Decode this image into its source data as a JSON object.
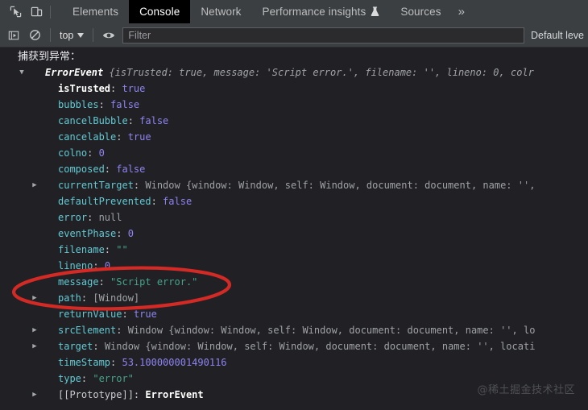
{
  "tabbar": {
    "inspect_icon": "inspect-element-icon",
    "device_icon": "device-toolbar-icon",
    "tabs": [
      {
        "label": "Elements",
        "active": false,
        "experimental": false
      },
      {
        "label": "Console",
        "active": true,
        "experimental": false
      },
      {
        "label": "Network",
        "active": false,
        "experimental": false
      },
      {
        "label": "Performance insights",
        "active": false,
        "experimental": true
      },
      {
        "label": "Sources",
        "active": false,
        "experimental": false
      }
    ],
    "more_label": "»"
  },
  "toolbar": {
    "sidebar_icon": "console-sidebar-icon",
    "clear_icon": "clear-console-icon",
    "context_label": "top",
    "eye_icon": "live-expression-eye-icon",
    "filter_placeholder": "Filter",
    "filter_value": "",
    "level_label": "Default leve"
  },
  "console": {
    "first_line": "捕获到异常：",
    "header": {
      "class_name": "ErrorEvent",
      "preview": " {isTrusted: true, message: 'Script error.', filename: '', lineno: 0, colr"
    },
    "properties": [
      {
        "key": "isTrusted",
        "bold_key": true,
        "value": "true",
        "kind": "bool",
        "expandable": false
      },
      {
        "key": "bubbles",
        "value": "false",
        "kind": "bool",
        "expandable": false
      },
      {
        "key": "cancelBubble",
        "value": "false",
        "kind": "bool",
        "expandable": false
      },
      {
        "key": "cancelable",
        "value": "true",
        "kind": "bool",
        "expandable": false
      },
      {
        "key": "colno",
        "value": "0",
        "kind": "num",
        "expandable": false
      },
      {
        "key": "composed",
        "value": "false",
        "kind": "bool",
        "expandable": false
      },
      {
        "key": "currentTarget",
        "value": "Window {window: Window, self: Window, document: document, name: '',",
        "kind": "window",
        "expandable": true
      },
      {
        "key": "defaultPrevented",
        "value": "false",
        "kind": "bool",
        "expandable": false
      },
      {
        "key": "error",
        "value": "null",
        "kind": "null",
        "expandable": false
      },
      {
        "key": "eventPhase",
        "value": "0",
        "kind": "num",
        "expandable": false
      },
      {
        "key": "filename",
        "value": "\"\"",
        "kind": "string",
        "expandable": false
      },
      {
        "key": "lineno",
        "value": "0",
        "kind": "num",
        "expandable": false
      },
      {
        "key": "message",
        "value": "\"Script error.\"",
        "kind": "string",
        "expandable": false
      },
      {
        "key": "path",
        "value": "[Window]",
        "kind": "array",
        "expandable": true
      },
      {
        "key": "returnValue",
        "value": "true",
        "kind": "bool",
        "expandable": false
      },
      {
        "key": "srcElement",
        "value": "Window {window: Window, self: Window, document: document, name: '', lo",
        "kind": "window",
        "expandable": true
      },
      {
        "key": "target",
        "value": "Window {window: Window, self: Window, document: document, name: '', locati",
        "kind": "window",
        "expandable": true
      },
      {
        "key": "timeStamp",
        "value": "53.100000001490116",
        "kind": "num",
        "expandable": false
      },
      {
        "key": "type",
        "value": "\"error\"",
        "kind": "string",
        "expandable": false
      },
      {
        "key": "[[Prototype]]",
        "value": "ErrorEvent",
        "kind": "proto",
        "expandable": true
      }
    ],
    "annotation": {
      "shape": "ellipse",
      "color": "#d42a25",
      "targets": "message: \"Script error.\""
    },
    "watermark": "@稀土掘金技术社区"
  }
}
